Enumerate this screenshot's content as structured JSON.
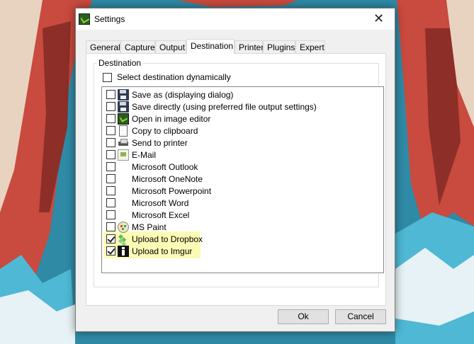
{
  "dialog": {
    "title": "Settings",
    "close_symbol": "✕",
    "app_icon": "greenshot-icon"
  },
  "tabs": [
    {
      "label": "General"
    },
    {
      "label": "Capture"
    },
    {
      "label": "Output"
    },
    {
      "label": "Destination",
      "active": true
    },
    {
      "label": "Printer"
    },
    {
      "label": "Plugins"
    },
    {
      "label": "Expert"
    }
  ],
  "destination_group": {
    "legend": "Destination",
    "dynamic_label": "Select destination dynamically",
    "dynamic_checked": false,
    "items": [
      {
        "label": "Save as (displaying dialog)",
        "icon": "floppy-icon",
        "checked": false
      },
      {
        "label": "Save directly (using preferred file output settings)",
        "icon": "floppy-icon",
        "checked": false
      },
      {
        "label": "Open in image editor",
        "icon": "image-editor-icon",
        "checked": false
      },
      {
        "label": "Copy to clipboard",
        "icon": "clipboard-icon",
        "checked": false
      },
      {
        "label": "Send to printer",
        "icon": "printer-icon",
        "checked": false
      },
      {
        "label": "E-Mail",
        "icon": "email-icon",
        "checked": false
      },
      {
        "label": "Microsoft Outlook",
        "icon": "",
        "checked": false
      },
      {
        "label": "Microsoft OneNote",
        "icon": "",
        "checked": false
      },
      {
        "label": "Microsoft Powerpoint",
        "icon": "",
        "checked": false
      },
      {
        "label": "Microsoft Word",
        "icon": "",
        "checked": false
      },
      {
        "label": "Microsoft Excel",
        "icon": "",
        "checked": false
      },
      {
        "label": "MS Paint",
        "icon": "paint-icon",
        "checked": false
      },
      {
        "label": "Upload to Dropbox",
        "icon": "dropbox-icon",
        "checked": true
      },
      {
        "label": "Upload to Imgur",
        "icon": "imgur-icon",
        "checked": true
      }
    ]
  },
  "buttons": {
    "ok": "Ok",
    "cancel": "Cancel"
  },
  "colors": {
    "highlight": "#fbfbb6",
    "dialog_bg": "#f0f0f0"
  }
}
